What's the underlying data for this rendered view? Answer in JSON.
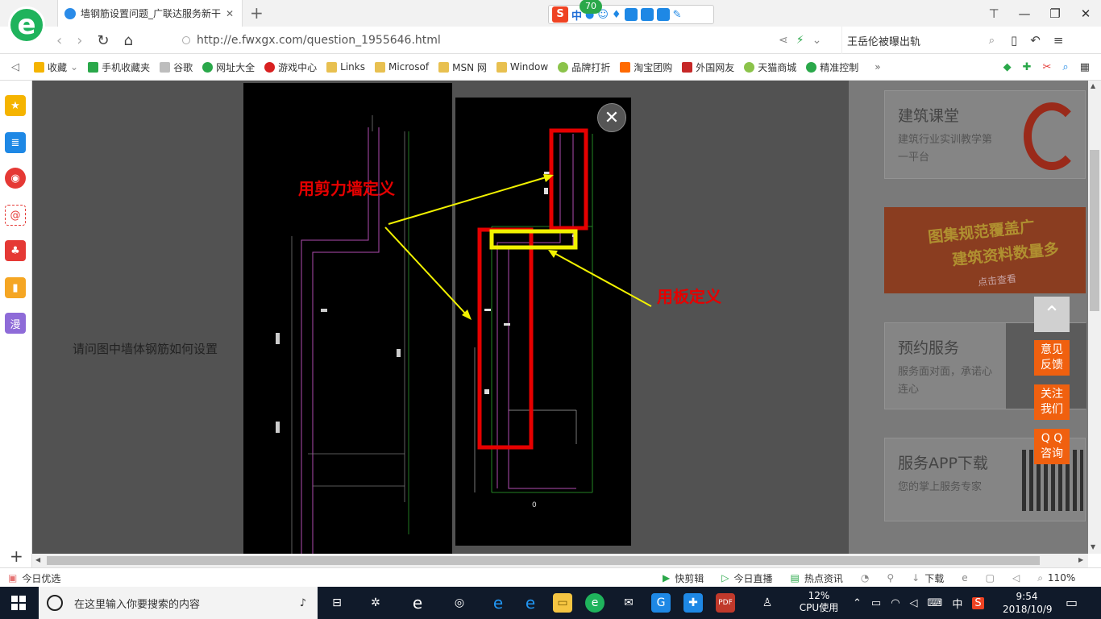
{
  "browser": {
    "tab_title": "墙钢筋设置问题_广联达服务新干",
    "ime_badge": "70",
    "ime_mode": "中",
    "url": "http://e.fwxgx.com/question_1955646.html",
    "search_text": "王岳伦被曝出轨"
  },
  "bookmarks": [
    {
      "label": "收藏",
      "color": "#f5b400"
    },
    {
      "label": "手机收藏夹",
      "color": "#2aa84a"
    },
    {
      "label": "谷歌",
      "color": "#9e9e9e"
    },
    {
      "label": "网址大全",
      "color": "#2aa84a"
    },
    {
      "label": "游戏中心",
      "color": "#d82020"
    },
    {
      "label": "Links",
      "color": "#e8c050"
    },
    {
      "label": "Microsof",
      "color": "#e8c050"
    },
    {
      "label": "MSN 网",
      "color": "#e8c050"
    },
    {
      "label": "Window",
      "color": "#e8c050"
    },
    {
      "label": "品牌打折",
      "color": "#8bc34a"
    },
    {
      "label": "淘宝团购",
      "color": "#ff6a00"
    },
    {
      "label": "外国网友",
      "color": "#c62828"
    },
    {
      "label": "天猫商城",
      "color": "#8bc34a"
    },
    {
      "label": "精准控制",
      "color": "#2aa84a"
    }
  ],
  "sidebar_last_label": "漫",
  "page": {
    "question": "请问图中墙体钢筋如何设置",
    "label_shear_wall": "用剪力墙定义",
    "label_slab": "用板定义",
    "drawing_caption": "0",
    "close_symbol": "✕"
  },
  "right_panel": {
    "card1": {
      "title": "建筑课堂",
      "subtitle": "建筑行业实训教学第一平台"
    },
    "banner": {
      "line1": "图集规范覆盖广",
      "line2": "建筑资料数量多",
      "cta": "点击查看"
    },
    "card2": {
      "title": "预约服务",
      "subtitle": "服务面对面，承诺心连心"
    },
    "card3": {
      "title": "服务APP下载",
      "subtitle": "您的掌上服务专家"
    },
    "float_buttons": [
      {
        "line1": "意见",
        "line2": "反馈"
      },
      {
        "line1": "关注",
        "line2": "我们"
      },
      {
        "line1": "Q Q",
        "line2": "咨询"
      }
    ]
  },
  "statusbar": {
    "left": "今日优选",
    "items": [
      "快剪辑",
      "今日直播",
      "热点资讯",
      "下载"
    ],
    "zoom": "110%"
  },
  "taskbar": {
    "search_placeholder": "在这里输入你要搜索的内容",
    "cpu_percent": "12%",
    "cpu_label": "CPU使用",
    "ime": "中",
    "time": "9:54",
    "date": "2018/10/9"
  },
  "colors": {
    "brand_green": "#1fb35c",
    "annotation_red": "#e60000",
    "annotation_yellow": "#f2f200",
    "float_orange": "#f0600f",
    "overlay": "#525252"
  }
}
